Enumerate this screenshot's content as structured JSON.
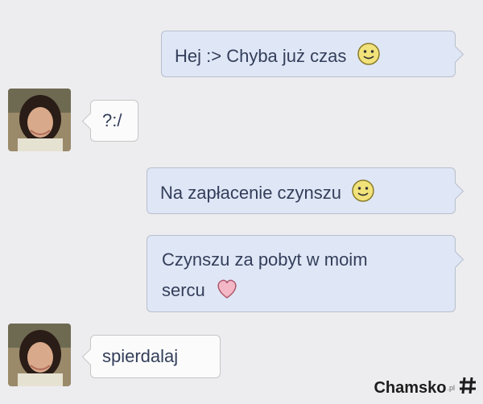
{
  "messages": [
    {
      "side": "out",
      "text": "Hej :> Chyba już czas",
      "emoji": "smile-emoji"
    },
    {
      "side": "in",
      "text": "?:/"
    },
    {
      "side": "out",
      "text": "Na zapłacenie czynszu",
      "emoji": "smile-emoji"
    },
    {
      "side": "out",
      "line1": "Czynszu za pobyt w moim",
      "line2": "sercu",
      "emoji": "heart-emoji"
    },
    {
      "side": "in",
      "text": "spierdalaj"
    }
  ],
  "watermark": {
    "brand": "Chamsko",
    "domain": ".pl"
  },
  "colors": {
    "background": "#ededf0",
    "outgoing": "#dfe7f6",
    "incoming": "#fbfbfb",
    "text": "#333e5a"
  }
}
